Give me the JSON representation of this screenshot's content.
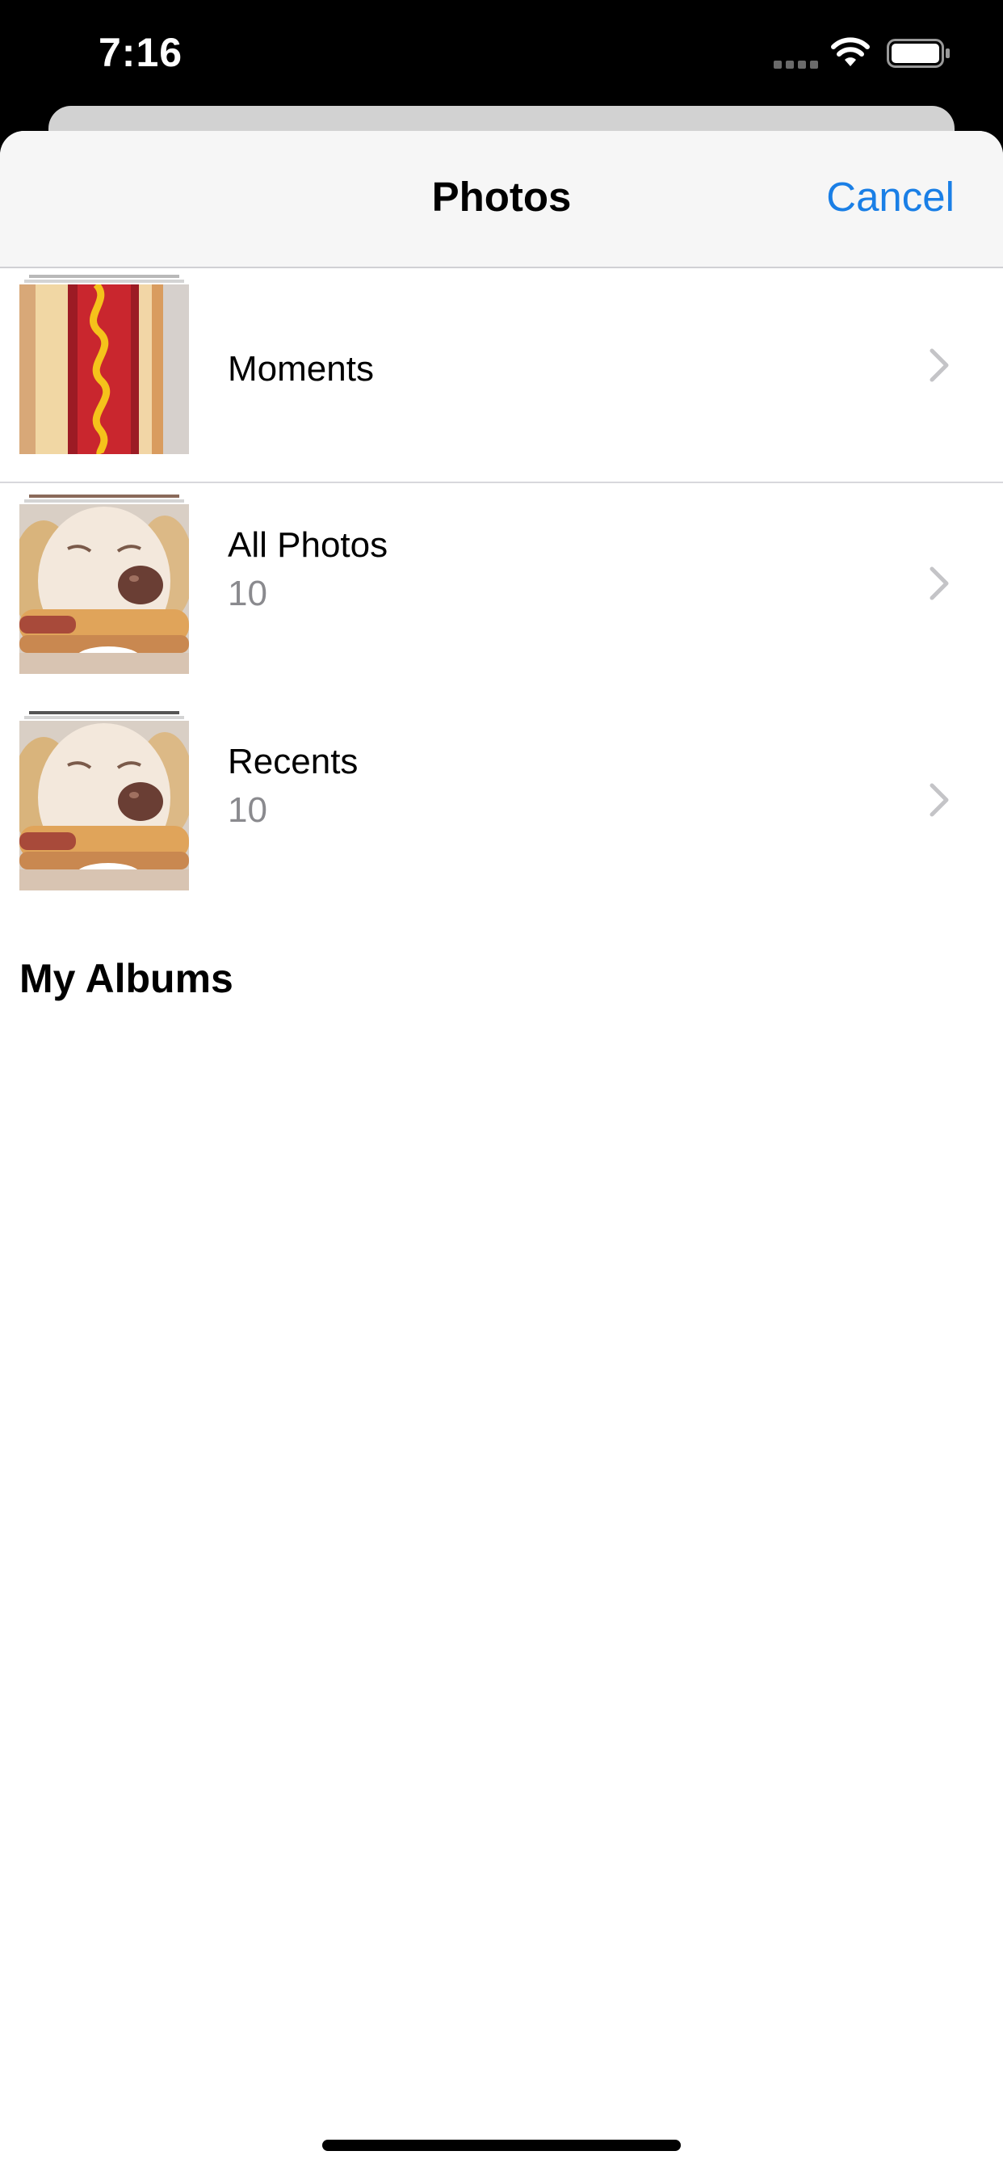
{
  "status_bar": {
    "time": "7:16",
    "icons": [
      "signal-icon",
      "wifi-icon",
      "battery-icon"
    ]
  },
  "nav": {
    "title": "Photos",
    "cancel_label": "Cancel"
  },
  "albums": [
    {
      "title": "Moments",
      "count": "",
      "thumbnail": "hot-dog-photo"
    },
    {
      "title": "All Photos",
      "count": "10",
      "thumbnail": "dog-with-hot-dog-photo"
    },
    {
      "title": "Recents",
      "count": "10",
      "thumbnail": "dog-with-hot-dog-photo"
    }
  ],
  "section_header": "My Albums",
  "colors": {
    "accent": "#1a7fe6",
    "nav_background": "#f6f6f6",
    "secondary_text": "#8a8a8e",
    "chevron": "#c4c4c7"
  }
}
